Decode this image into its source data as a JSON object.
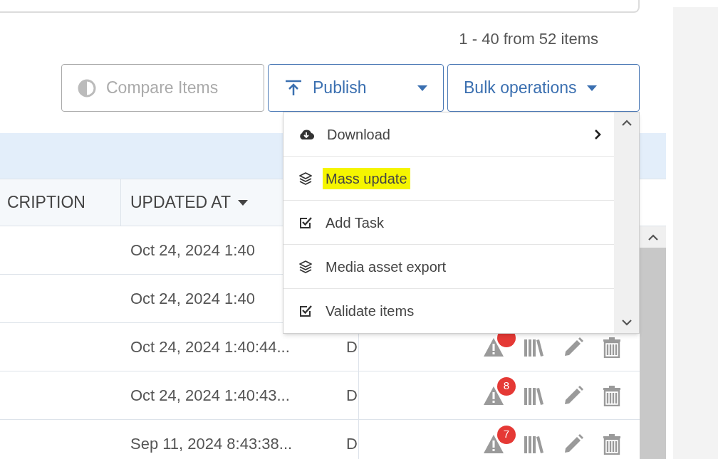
{
  "count_label": "1 - 40 from 52 items",
  "buttons": [
    {
      "label": "Compare Items",
      "kind": "compare",
      "disabled": true
    },
    {
      "label": "Publish",
      "kind": "publish",
      "disabled": false
    },
    {
      "label": "Bulk operations",
      "kind": "bulk",
      "disabled": false
    }
  ],
  "table": {
    "columns": [
      {
        "label": "CRIPTION",
        "sorted": false
      },
      {
        "label": "UPDATED AT",
        "sorted": true
      }
    ],
    "rows": [
      {
        "updated_at": "Oct 24, 2024 1:40",
        "show_actions": false
      },
      {
        "updated_at": "Oct 24, 2024 1:40",
        "show_actions": false
      },
      {
        "updated_at": "Oct 24, 2024 1:40:44...",
        "column_3": "D",
        "show_actions": true
      },
      {
        "updated_at": "Oct 24, 2024 1:40:43...",
        "column_3": "D",
        "show_actions": true,
        "badge": "8"
      },
      {
        "updated_at": "Sep 11, 2024 8:43:38...",
        "column_3": "D",
        "show_actions": true,
        "badge": "7"
      }
    ]
  },
  "dropdown": {
    "items": [
      {
        "label": "Download",
        "kind": "download",
        "submenu": true,
        "highlighted": false
      },
      {
        "label": "Mass update",
        "kind": "update",
        "submenu": false,
        "highlighted": true
      },
      {
        "label": "Add Task",
        "kind": "task",
        "submenu": false,
        "highlighted": false
      },
      {
        "label": "Media asset export",
        "kind": "export",
        "submenu": false,
        "highlighted": false
      },
      {
        "label": "Validate items",
        "kind": "validate",
        "submenu": false,
        "highlighted": false
      }
    ]
  }
}
